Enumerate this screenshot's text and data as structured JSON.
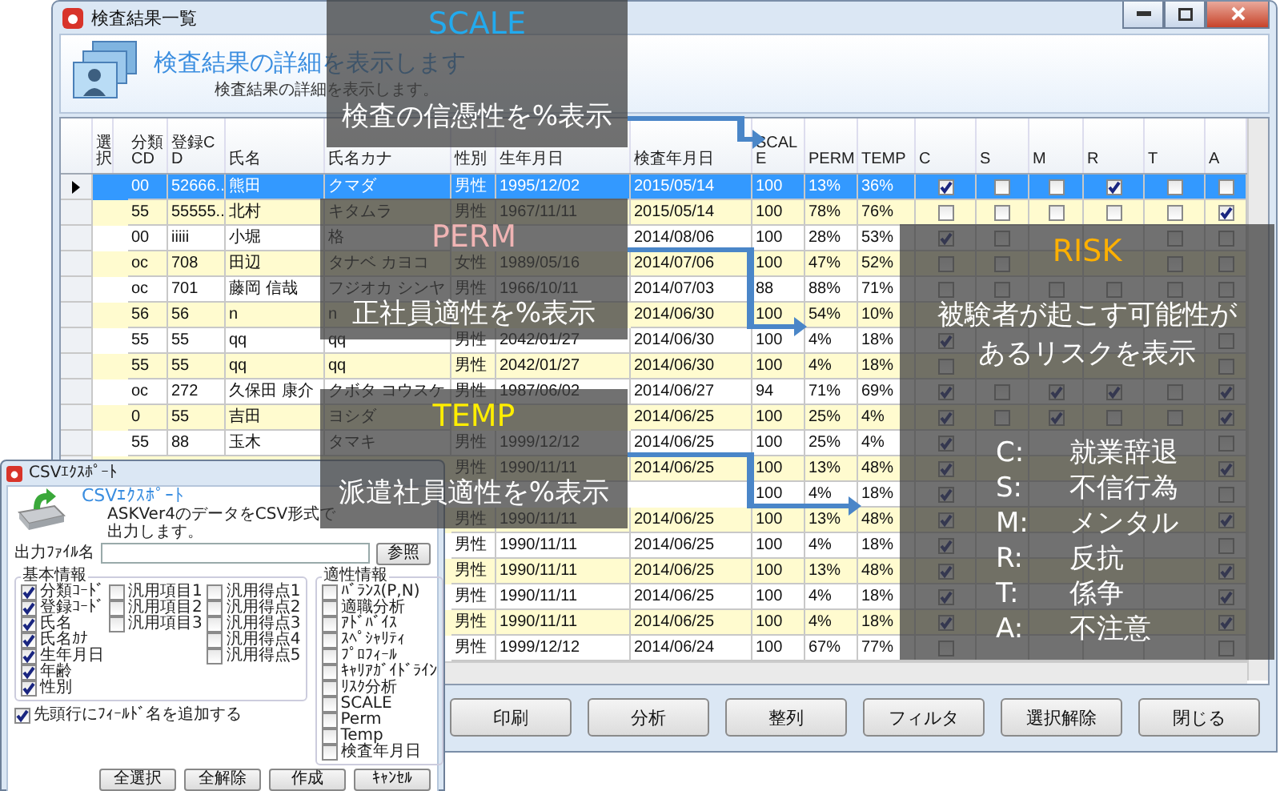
{
  "window": {
    "title": "検査結果一覧",
    "heading": "検査結果の詳細を表示します",
    "subheading": "検査結果の詳細を表示します。"
  },
  "table": {
    "columns": [
      "選択",
      "分類CD",
      "登録CD",
      "氏名",
      "氏名カナ",
      "性別",
      "生年月日",
      "検査年月日",
      "SCALE",
      "PERM",
      "TEMP",
      "C",
      "S",
      "M",
      "R",
      "T",
      "A"
    ],
    "rows": [
      {
        "selected": true,
        "class_cd": "00",
        "reg_cd": "52666..",
        "name": "熊田",
        "kana": "クマダ",
        "gender": "男性",
        "birth_date": "1995/12/02",
        "test_date": "2015/05/14",
        "scale": "100",
        "perm": "13%",
        "temp": "36%",
        "risk": {
          "c": true,
          "s": false,
          "m": false,
          "r": true,
          "t": false,
          "a": false
        }
      },
      {
        "selected": false,
        "class_cd": "55",
        "reg_cd": "55555..",
        "name": "北村",
        "kana": "キタムラ",
        "gender": "男性",
        "birth_date": "1967/11/11",
        "test_date": "2015/05/14",
        "scale": "100",
        "perm": "78%",
        "temp": "76%",
        "risk": {
          "c": false,
          "s": false,
          "m": false,
          "r": false,
          "t": false,
          "a": true
        }
      },
      {
        "selected": false,
        "class_cd": "00",
        "reg_cd": "iiiii",
        "name": "小堀",
        "kana": "格",
        "test_date": "2014/08/06",
        "scale": "100",
        "perm": "28%",
        "temp": "53%",
        "risk": {
          "c": true,
          "s": false,
          "t": false,
          "a": false
        }
      },
      {
        "selected": false,
        "class_cd": "oc",
        "reg_cd": "708",
        "name": "田辺",
        "kana": "タナベ カヨコ",
        "gender": "女性",
        "birth_date": "1989/05/16",
        "test_date": "2014/07/06",
        "scale": "100",
        "perm": "47%",
        "temp": "52%",
        "risk": {
          "c": false,
          "s": false,
          "t": false,
          "a": false
        }
      },
      {
        "selected": false,
        "class_cd": "oc",
        "reg_cd": "701",
        "name": "藤岡 信哉",
        "kana": "フジオカ シンヤ",
        "gender": "男性",
        "birth_date": "1966/10/11",
        "test_date": "2014/07/03",
        "scale": "88",
        "perm": "88%",
        "temp": "71%",
        "risk": {
          "c": false,
          "s": false,
          "m": false,
          "r": false,
          "t": false,
          "a": false
        }
      },
      {
        "selected": false,
        "class_cd": "56",
        "reg_cd": "56",
        "name": "n",
        "kana": "n",
        "test_date": "2014/06/30",
        "scale": "100",
        "perm": "54%",
        "temp": "10%"
      },
      {
        "selected": false,
        "class_cd": "55",
        "reg_cd": "55",
        "name": "qq",
        "kana": "qq",
        "gender": "男性",
        "birth_date": "2042/01/27",
        "test_date": "2014/06/30",
        "scale": "100",
        "perm": "4%",
        "temp": "18%",
        "risk": {
          "c": true,
          "a": false
        }
      },
      {
        "selected": false,
        "class_cd": "55",
        "reg_cd": "55",
        "name": "qq",
        "kana": "qq",
        "gender": "男性",
        "birth_date": "2042/01/27",
        "test_date": "2014/06/30",
        "scale": "100",
        "perm": "4%",
        "temp": "18%",
        "risk": {
          "c": false,
          "a": false
        }
      },
      {
        "selected": false,
        "class_cd": "oc",
        "reg_cd": "272",
        "name": "久保田 康介",
        "kana": "クボタ コウスケ",
        "gender": "男性",
        "birth_date": "1987/06/02",
        "test_date": "2014/06/27",
        "scale": "94",
        "perm": "71%",
        "temp": "69%",
        "risk": {
          "c": true,
          "s": false,
          "m": true,
          "r": true,
          "t": false,
          "a": true
        }
      },
      {
        "selected": false,
        "class_cd": "0",
        "reg_cd": "55",
        "name": "吉田",
        "kana": "ヨシダ",
        "test_date": "2014/06/25",
        "scale": "100",
        "perm": "25%",
        "temp": "4%",
        "risk": {
          "c": true,
          "s": false,
          "m": true,
          "r": false,
          "t": false,
          "a": true
        }
      },
      {
        "selected": false,
        "class_cd": "55",
        "reg_cd": "88",
        "name": "玉木",
        "kana": "タマキ",
        "gender": "男性",
        "birth_date": "1999/12/12",
        "test_date": "2014/06/25",
        "scale": "100",
        "perm": "25%",
        "temp": "4%",
        "risk": {
          "c": true,
          "a": false
        }
      },
      {
        "selected": false,
        "gender": "男性",
        "birth_date": "1990/11/11",
        "test_date": "2014/06/25",
        "scale": "100",
        "perm": "13%",
        "temp": "48%",
        "risk": {
          "c": true,
          "a": true
        }
      },
      {
        "selected": false,
        "scale": "100",
        "perm": "4%",
        "temp": "18%",
        "risk": {
          "c": true,
          "a": false
        }
      },
      {
        "selected": false,
        "gender": "男性",
        "birth_date": "1990/11/11",
        "test_date": "2014/06/25",
        "scale": "100",
        "perm": "13%",
        "temp": "48%",
        "risk": {
          "c": true,
          "a": true
        }
      },
      {
        "selected": false,
        "gender": "男性",
        "birth_date": "1990/11/11",
        "test_date": "2014/06/25",
        "scale": "100",
        "perm": "4%",
        "temp": "18%",
        "risk": {
          "c": true,
          "a": false
        }
      },
      {
        "selected": false,
        "gender": "男性",
        "birth_date": "1990/11/11",
        "test_date": "2014/06/25",
        "scale": "100",
        "perm": "13%",
        "temp": "48%",
        "risk": {
          "c": true,
          "a": true
        }
      },
      {
        "selected": false,
        "gender": "男性",
        "birth_date": "1990/11/11",
        "test_date": "2014/06/25",
        "scale": "100",
        "perm": "4%",
        "temp": "18%",
        "risk": {
          "c": true,
          "a": true
        }
      },
      {
        "selected": false,
        "gender": "男性",
        "birth_date": "1990/11/11",
        "test_date": "2014/06/25",
        "scale": "100",
        "perm": "4%",
        "temp": "18%",
        "risk": {
          "c": true,
          "a": true
        }
      },
      {
        "selected": false,
        "gender": "男性",
        "birth_date": "1999/12/12",
        "test_date": "2014/06/24",
        "scale": "100",
        "perm": "67%",
        "temp": "77%",
        "risk": {
          "c": false,
          "a": false
        }
      }
    ]
  },
  "buttons": [
    "印刷",
    "分析",
    "整列",
    "フィルタ",
    "選択解除",
    "閉じる"
  ],
  "callouts": [
    {
      "kind": "scale",
      "title": "SCALE",
      "color": "#22aaee",
      "lines": [
        "検査の信憑性を%表示"
      ]
    },
    {
      "kind": "perm",
      "title": "PERM",
      "color": "#f0b4b4",
      "lines": [
        "正社員適性を%表示"
      ]
    },
    {
      "kind": "temp",
      "title": "TEMP",
      "color": "#ffee00",
      "lines": [
        "派遣社員適性を%表示"
      ]
    },
    {
      "kind": "risk",
      "title": "RISK",
      "color": "#ffb000",
      "lines": [
        "被験者が起こす可能性が",
        "あるリスクを表示"
      ],
      "legend": [
        {
          "key": "C:",
          "label": "就業辞退"
        },
        {
          "key": "S:",
          "label": "不信行為"
        },
        {
          "key": "M:",
          "label": "メンタル"
        },
        {
          "key": "R:",
          "label": "反抗"
        },
        {
          "key": "T:",
          "label": "係争"
        },
        {
          "key": "A:",
          "label": "不注意"
        }
      ]
    }
  ],
  "csv_dialog": {
    "title": "CSVｴｸｽﾎﾟｰﾄ",
    "heading": "CSVｴｸｽﾎﾟｰﾄ",
    "subheading": "ASKVer4のデータをCSV形式で出力します。",
    "file_label": "出力ﾌｧｲﾙ名",
    "browse": "参照",
    "basic": {
      "label": "基本情報",
      "columns": [
        [
          {
            "label": "分類ｺｰﾄﾞ",
            "checked": true
          },
          {
            "label": "登録ｺｰﾄﾞ",
            "checked": true
          },
          {
            "label": "氏名",
            "checked": true
          },
          {
            "label": "氏名ｶﾅ",
            "checked": true
          },
          {
            "label": "生年月日",
            "checked": true
          },
          {
            "label": "年齢",
            "checked": true
          },
          {
            "label": "性別",
            "checked": true
          }
        ],
        [
          {
            "label": "汎用項目1",
            "checked": false
          },
          {
            "label": "汎用項目2",
            "checked": false
          },
          {
            "label": "汎用項目3",
            "checked": false
          }
        ],
        [
          {
            "label": "汎用得点1",
            "checked": false
          },
          {
            "label": "汎用得点2",
            "checked": false
          },
          {
            "label": "汎用得点3",
            "checked": false
          },
          {
            "label": "汎用得点4",
            "checked": false
          },
          {
            "label": "汎用得点5",
            "checked": false
          }
        ]
      ]
    },
    "aptitude": {
      "label": "適性情報",
      "items": [
        {
          "label": "ﾊﾞﾗﾝｽ(P,N)",
          "checked": false
        },
        {
          "label": "適職分析",
          "checked": false
        },
        {
          "label": "ｱﾄﾞﾊﾞｲｽ",
          "checked": false
        },
        {
          "label": "ｽﾍﾟｼｬﾘﾃｨ",
          "checked": false
        },
        {
          "label": "ﾌﾟﾛﾌｨｰﾙ",
          "checked": false
        },
        {
          "label": "ｷｬﾘｱｶﾞｲﾄﾞﾗｲﾝ",
          "checked": false
        },
        {
          "label": "ﾘｽｸ分析",
          "checked": false
        },
        {
          "label": "SCALE",
          "checked": false
        },
        {
          "label": "Perm",
          "checked": false
        },
        {
          "label": "Temp",
          "checked": false
        },
        {
          "label": "検査年月日",
          "checked": false
        }
      ]
    },
    "header_row": {
      "label": "先頭行にﾌｨｰﾙﾄﾞ名を追加する",
      "checked": true
    },
    "buttons": [
      "全選択",
      "全解除",
      "作成",
      "ｷｬﾝｾﾙ"
    ]
  }
}
